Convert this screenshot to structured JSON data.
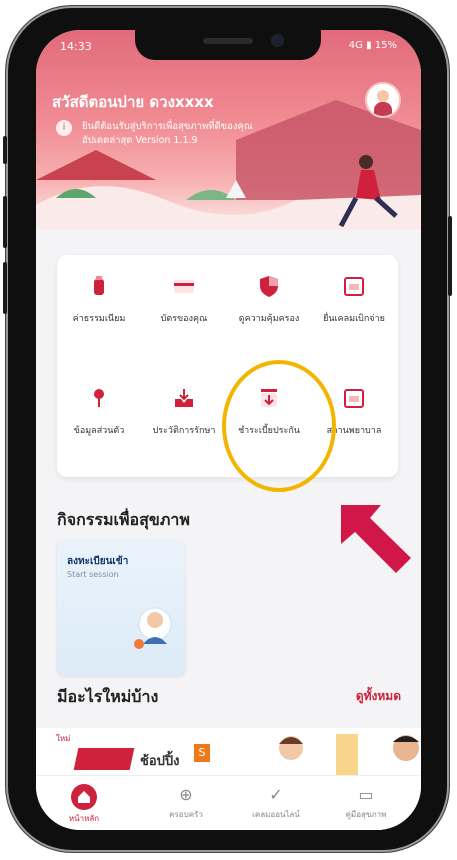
{
  "status": {
    "time": "14:33",
    "right": "4G ▮ 15%"
  },
  "header": {
    "greeting": "สวัสดีตอนบ่าย ดวงxxxx",
    "info_line1": "ยินดีต้อนรับสู่บริการเพื่อสุขภาพที่ดีของคุณ",
    "info_line2": "อัปเดตล่าสุด Version 1.1.9"
  },
  "menu": {
    "items": [
      {
        "label": "ค่าธรรมเนียม",
        "icon": "bottle-icon"
      },
      {
        "label": "บัตรของคุณ",
        "icon": "card-icon"
      },
      {
        "label": "ดูความคุ้มครอง",
        "icon": "shield-icon"
      },
      {
        "label": "ยื่นเคลมเบิกจ่าย",
        "icon": "calendar-icon"
      },
      {
        "label": "ข้อมูลส่วนตัว",
        "icon": "pin-icon"
      },
      {
        "label": "ประวัติการรักษา",
        "icon": "inbox-icon"
      },
      {
        "label": "ชำระเบี้ยประกัน",
        "icon": "download-icon"
      },
      {
        "label": "สถานพยาบาล",
        "icon": "calendar-icon"
      }
    ]
  },
  "sections": {
    "health_activity_title": "กิจกรรมเพื่อสุขภาพ",
    "activity_card_title": "ลงทะเบียนเข้า",
    "activity_card_sub": "Start session",
    "whats_new_title": "มีอะไรใหม่บ้าง",
    "see_all": "ดูทั้งหมด",
    "promo_tag": "ใหม่",
    "promo_text": "ช้อปปิ้ง",
    "promo_badge": "S"
  },
  "tabbar": {
    "tabs": [
      {
        "label": "หน้าหลัก",
        "icon": "home-icon"
      },
      {
        "label": "ครอบครัว",
        "icon": "globe-icon"
      },
      {
        "label": "เคลมออนไลน์",
        "icon": "check-icon"
      },
      {
        "label": "คู่มือสุขภาพ",
        "icon": "book-icon"
      }
    ]
  },
  "colors": {
    "brand": "#d0213c",
    "highlight": "#f2b500",
    "banner": "#e26a7a"
  }
}
